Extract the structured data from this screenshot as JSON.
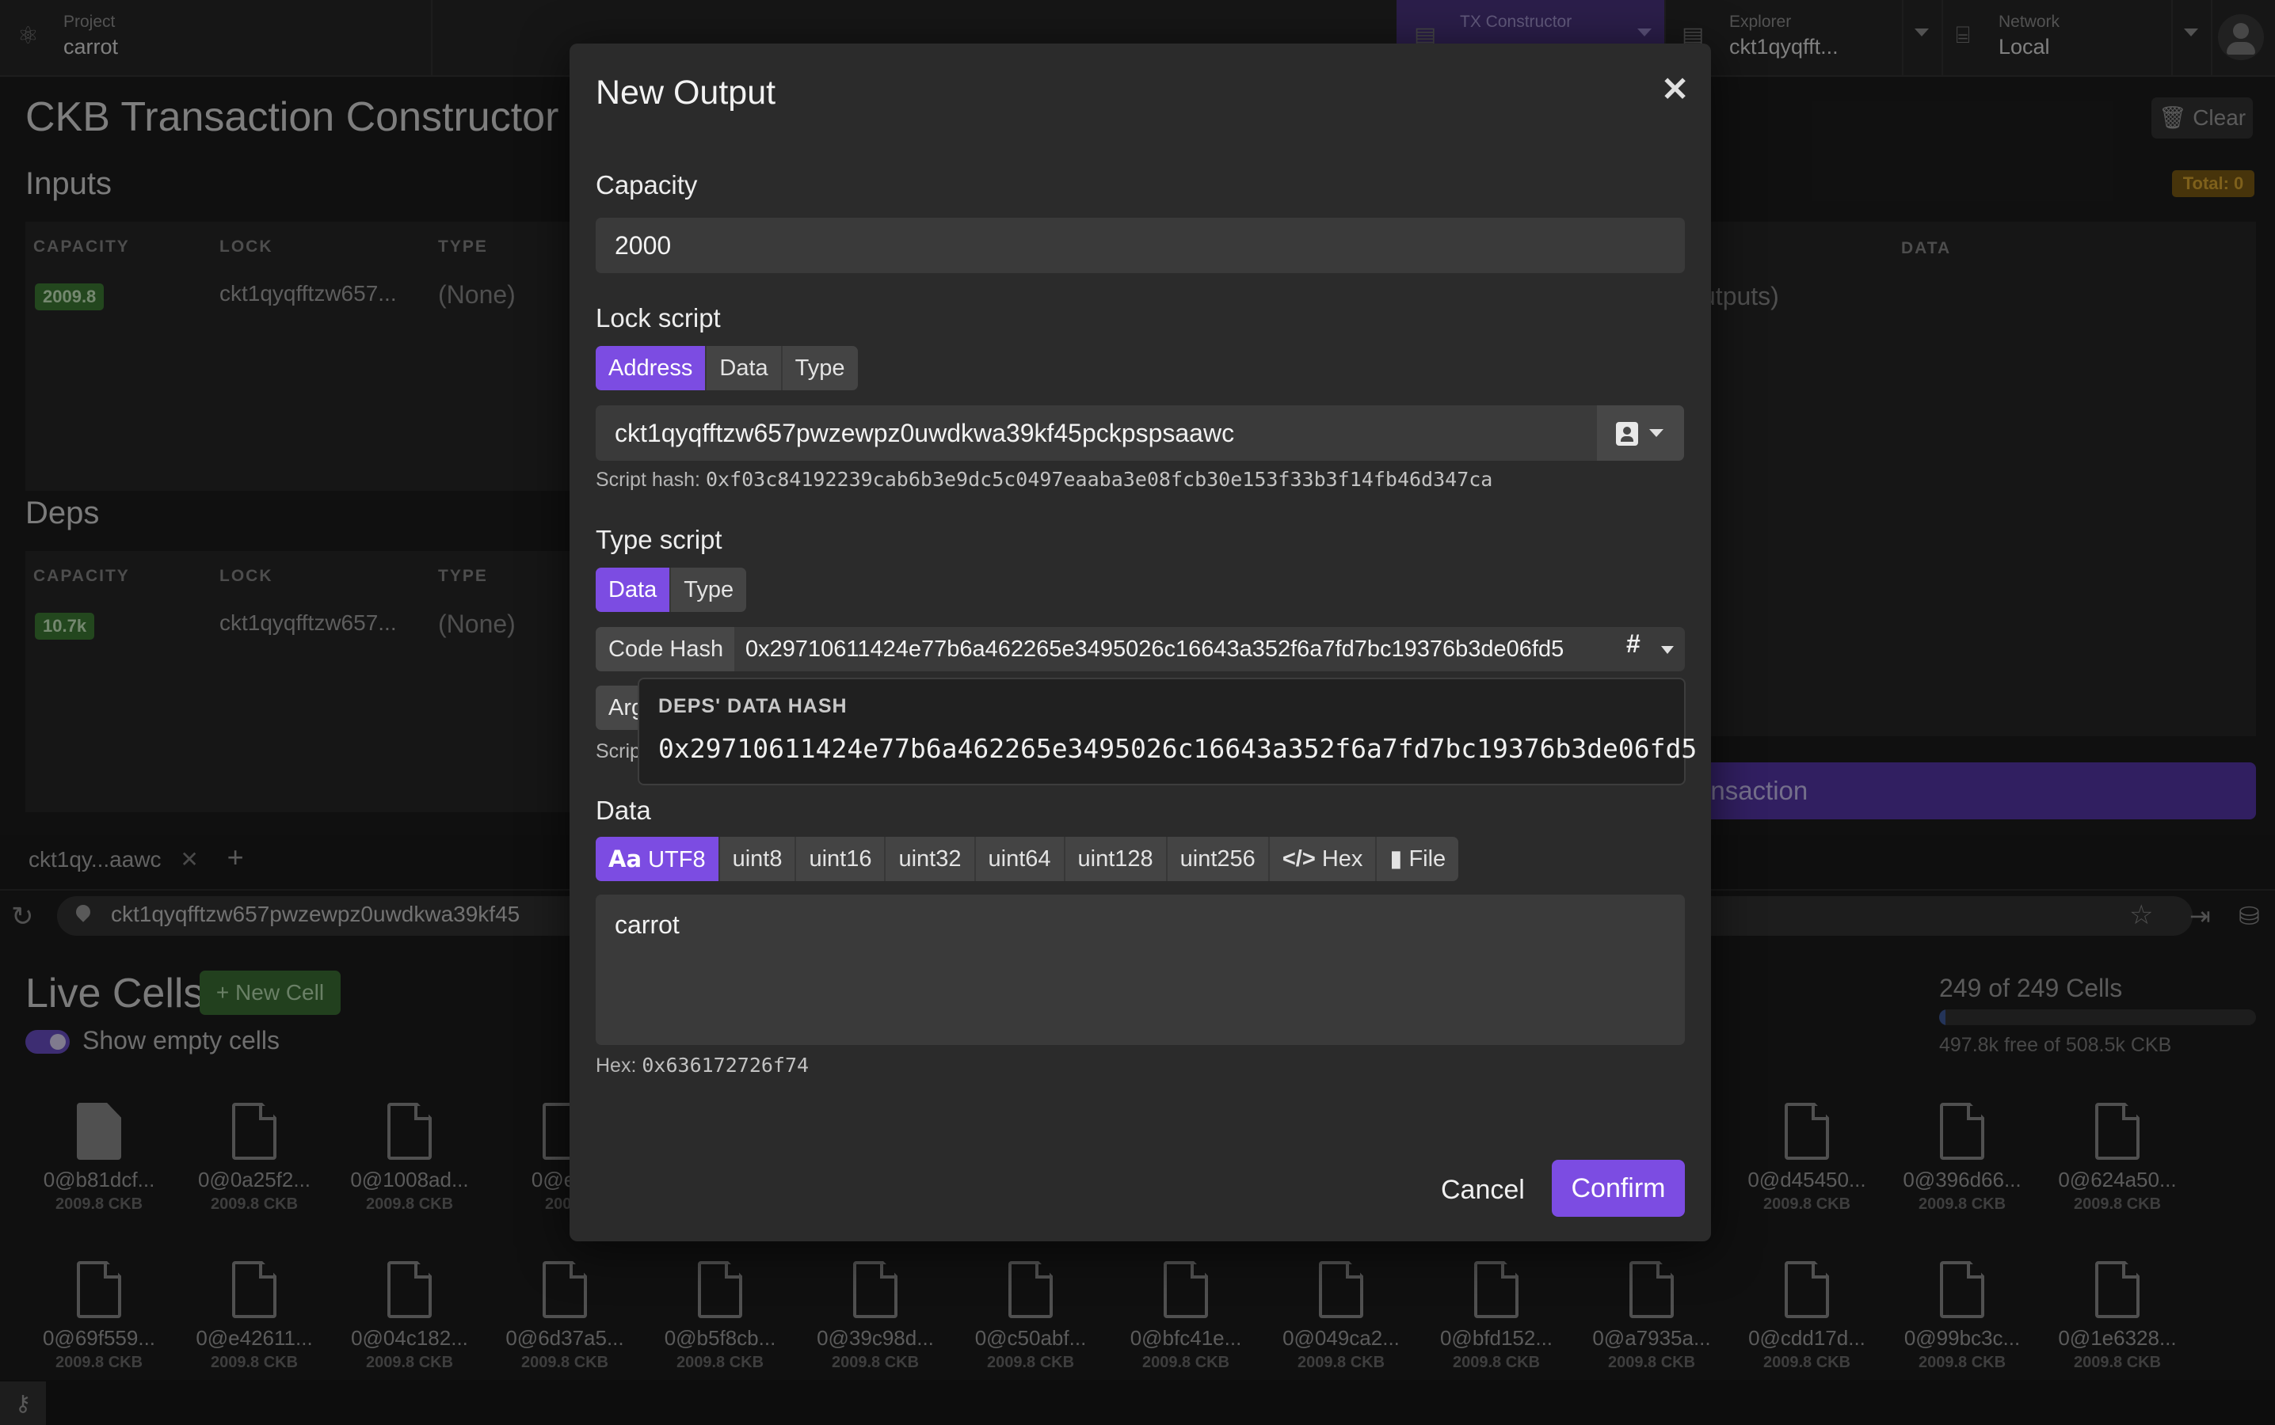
{
  "topbar": {
    "project_label": "Project",
    "project_name": "carrot",
    "tx_label": "TX Constructor",
    "explorer_label": "Explorer",
    "explorer_value": "ckt1qyqfft...",
    "network_label": "Network",
    "network_value": "Local"
  },
  "page": {
    "title": "CKB Transaction Constructor",
    "clear_label": "Clear",
    "total_label": "Total: 0",
    "inputs_title": "Inputs",
    "deps_title": "Deps",
    "col_capacity": "CAPACITY",
    "col_lock": "LOCK",
    "col_type": "TYPE",
    "col_data": "DATA",
    "inputs_row": {
      "capacity": "2009.8",
      "lock": "ckt1qyqfftzw657...",
      "type": "(None)"
    },
    "deps_row": {
      "capacity": "10.7k",
      "lock": "ckt1qyqfftzw657...",
      "type": "(None)"
    },
    "outputs_partial": "utputs)",
    "submit_partial": "ransaction"
  },
  "explorer": {
    "tab_label": "ckt1qy...aawc",
    "address": "ckt1qyqfftzw657pwzewpz0uwdkwa39kf45",
    "live_cells_title": "Live Cells",
    "new_cell_label": "New Cell",
    "show_empty_label": "Show empty cells",
    "cells_count": "249 of 249 Cells",
    "capacity_free": "497.8k free of 508.5k CKB",
    "capacity_used_fraction": 0.021,
    "cells_row1": [
      {
        "id": "0@b81dcf...",
        "cap": "2009.8 CKB"
      },
      {
        "id": "0@0a25f2...",
        "cap": "2009.8 CKB"
      },
      {
        "id": "0@1008ad...",
        "cap": "2009.8 CKB"
      },
      {
        "id": "0@e25",
        "cap": "2009."
      },
      {
        "id": "0@d45450...",
        "cap": "2009.8 CKB"
      },
      {
        "id": "0@396d66...",
        "cap": "2009.8 CKB"
      },
      {
        "id": "0@624a50...",
        "cap": "2009.8 CKB"
      }
    ],
    "cells_row2": [
      {
        "id": "0@69f559...",
        "cap": "2009.8 CKB"
      },
      {
        "id": "0@e42611...",
        "cap": "2009.8 CKB"
      },
      {
        "id": "0@04c182...",
        "cap": "2009.8 CKB"
      },
      {
        "id": "0@6d37a5...",
        "cap": "2009.8 CKB"
      },
      {
        "id": "0@b5f8cb...",
        "cap": "2009.8 CKB"
      },
      {
        "id": "0@39c98d...",
        "cap": "2009.8 CKB"
      },
      {
        "id": "0@c50abf...",
        "cap": "2009.8 CKB"
      },
      {
        "id": "0@bfc41e...",
        "cap": "2009.8 CKB"
      },
      {
        "id": "0@049ca2...",
        "cap": "2009.8 CKB"
      },
      {
        "id": "0@bfd152...",
        "cap": "2009.8 CKB"
      },
      {
        "id": "0@a7935a...",
        "cap": "2009.8 CKB"
      },
      {
        "id": "0@cdd17d...",
        "cap": "2009.8 CKB"
      },
      {
        "id": "0@99bc3c...",
        "cap": "2009.8 CKB"
      },
      {
        "id": "0@1e6328...",
        "cap": "2009.8 CKB"
      }
    ]
  },
  "modal": {
    "title": "New Output",
    "capacity_label": "Capacity",
    "capacity_value": "2000",
    "lock_label": "Lock script",
    "lock_tabs": [
      "Address",
      "Data",
      "Type"
    ],
    "lock_address": "ckt1qyqfftzw657pwzewpz0uwdkwa39kf45pckpspsaawc",
    "script_hash_label": "Script hash:",
    "script_hash_value": "0xf03c84192239cab6b3e9dc5c0497eaaba3e08fcb30e153f33b3f14fb46d347ca",
    "type_label": "Type script",
    "type_tabs": [
      "Data",
      "Type"
    ],
    "code_hash_label": "Code Hash",
    "code_hash_value": "0x29710611424e77b6a462265e3495026c16643a352f6a7fd7bc19376b3de06fd5",
    "args_partial": "Arg",
    "script_partial": "Scrip",
    "popover_title": "DEPS' DATA HASH",
    "popover_value": "0x29710611424e77b6a462265e3495026c16643a352f6a7fd7bc19376b3de06fd5",
    "data_label": "Data",
    "data_tabs": [
      "UTF8",
      "uint8",
      "uint16",
      "uint32",
      "uint64",
      "uint128",
      "uint256",
      "Hex",
      "File"
    ],
    "data_value": "carrot",
    "hex_label": "Hex:",
    "hex_value": "0x636172726f74",
    "cancel_label": "Cancel",
    "confirm_label": "Confirm"
  },
  "colors": {
    "accent": "#7c4ce2",
    "badge_green": "#3d7a34",
    "total_badge": "#d9a530"
  }
}
